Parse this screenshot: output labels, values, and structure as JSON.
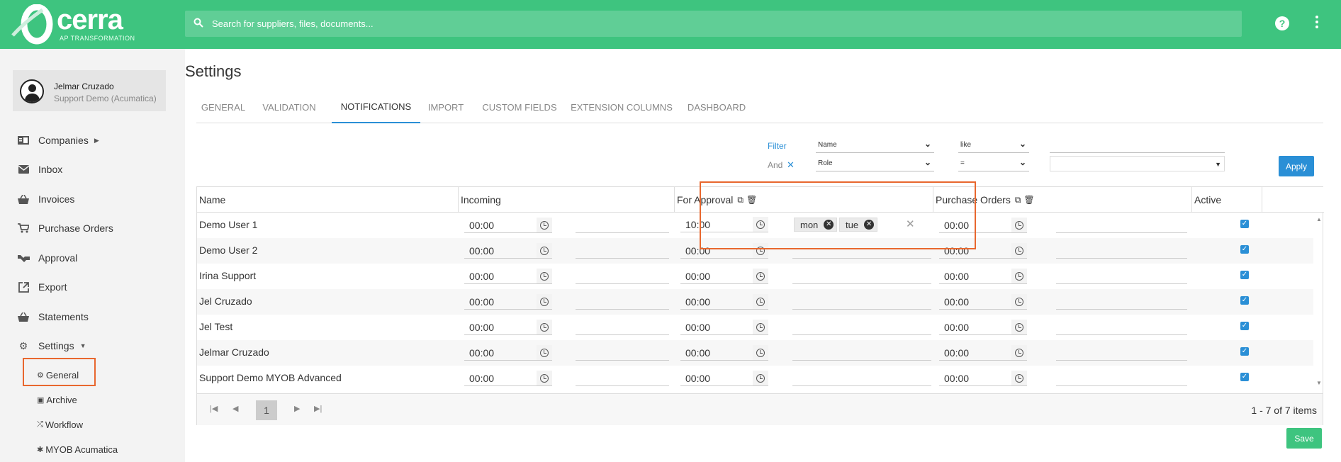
{
  "brand": {
    "name": "cerra",
    "tagline": "AP TRANSFORMATION",
    "accent": "#3ec47f"
  },
  "search": {
    "placeholder": "Search for suppliers, files, documents..."
  },
  "user": {
    "name": "Jelmar Cruzado",
    "company": "Support Demo (Acumatica)"
  },
  "sidebar": {
    "items": [
      {
        "label": "Companies",
        "icon": "card-icon"
      },
      {
        "label": "Inbox",
        "icon": "envelope-icon"
      },
      {
        "label": "Invoices",
        "icon": "basket-icon"
      },
      {
        "label": "Purchase Orders",
        "icon": "cart-icon"
      },
      {
        "label": "Approval",
        "icon": "handshake-icon"
      },
      {
        "label": "Export",
        "icon": "export-icon"
      },
      {
        "label": "Statements",
        "icon": "basket-icon"
      },
      {
        "label": "Settings",
        "icon": "gear-icon"
      }
    ],
    "subitems": [
      {
        "label": "General",
        "icon": "gear-icon"
      },
      {
        "label": "Archive",
        "icon": "archive-icon"
      },
      {
        "label": "Workflow",
        "icon": "workflow-icon"
      },
      {
        "label": "MYOB Acumatica",
        "icon": "puzzle-icon"
      }
    ]
  },
  "page": {
    "title": "Settings"
  },
  "tabs": [
    "GENERAL",
    "VALIDATION",
    "NOTIFICATIONS",
    "IMPORT",
    "CUSTOM FIELDS",
    "EXTENSION COLUMNS",
    "DASHBOARD"
  ],
  "active_tab": "NOTIFICATIONS",
  "filter": {
    "label": "Filter",
    "and_label": "And",
    "row1": {
      "field": "Name",
      "operator": "like",
      "value": ""
    },
    "row2": {
      "field": "Role",
      "operator": "=",
      "value": ""
    },
    "apply_label": "Apply"
  },
  "grid": {
    "columns": [
      "Name",
      "Incoming",
      "For Approval",
      "Purchase Orders",
      "Active"
    ],
    "rows": [
      {
        "name": "Demo User 1",
        "incoming": "00:00",
        "approval": "10:00",
        "approval_days": [
          "mon",
          "tue"
        ],
        "po": "00:00",
        "active": true
      },
      {
        "name": "Demo User 2",
        "incoming": "00:00",
        "approval": "00:00",
        "approval_days": [],
        "po": "00:00",
        "active": true
      },
      {
        "name": "Irina Support",
        "incoming": "00:00",
        "approval": "00:00",
        "approval_days": [],
        "po": "00:00",
        "active": true
      },
      {
        "name": "Jel Cruzado",
        "incoming": "00:00",
        "approval": "00:00",
        "approval_days": [],
        "po": "00:00",
        "active": true
      },
      {
        "name": "Jel Test",
        "incoming": "00:00",
        "approval": "00:00",
        "approval_days": [],
        "po": "00:00",
        "active": true
      },
      {
        "name": "Jelmar Cruzado",
        "incoming": "00:00",
        "approval": "00:00",
        "approval_days": [],
        "po": "00:00",
        "active": true
      },
      {
        "name": "Support Demo MYOB Advanced",
        "incoming": "00:00",
        "approval": "00:00",
        "approval_days": [],
        "po": "00:00",
        "active": true
      }
    ]
  },
  "pager": {
    "current_page": "1",
    "info": "1 - 7 of 7 items"
  },
  "save_label": "Save",
  "colors": {
    "primary": "#2a8fd6",
    "highlight": "#e8672e"
  }
}
